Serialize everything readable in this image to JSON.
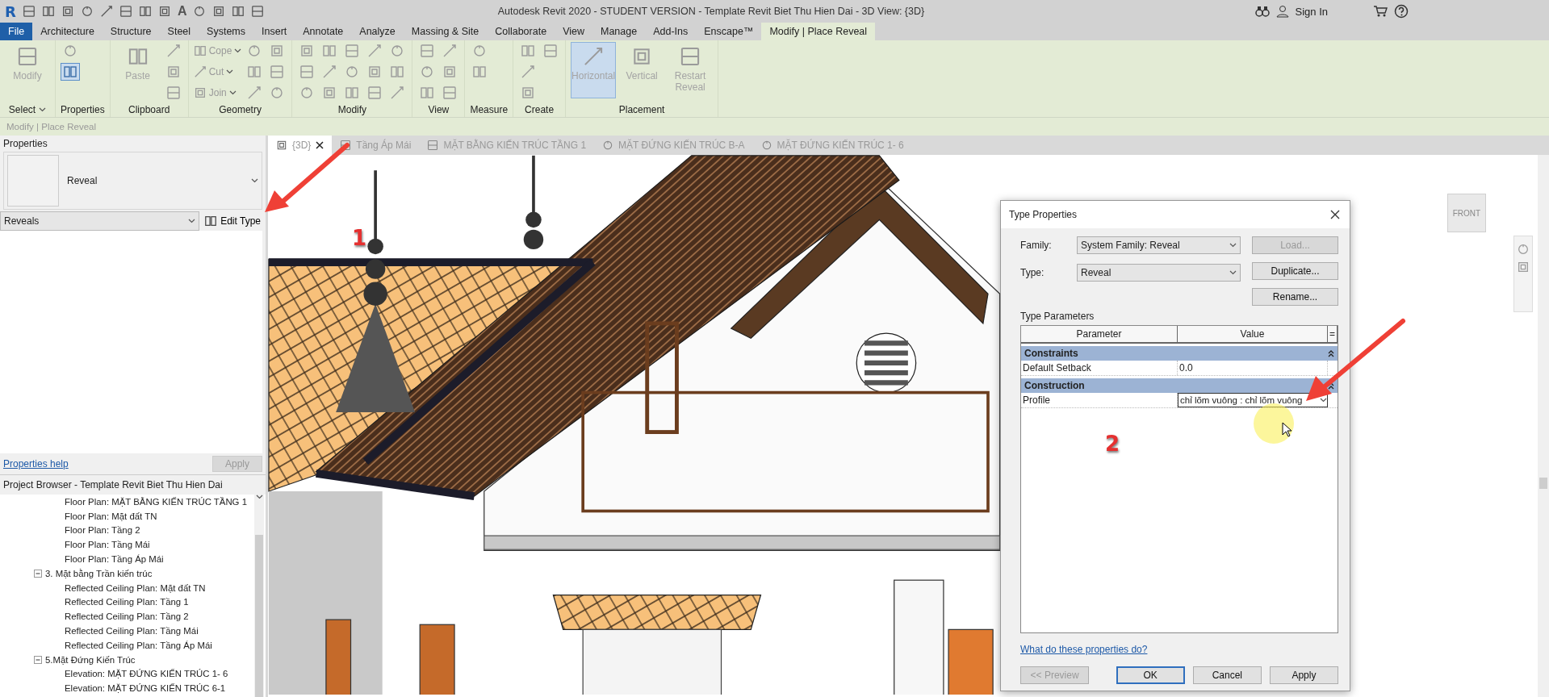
{
  "title_bar": {
    "logo": "R",
    "text_tool": "A",
    "title": "Autodesk Revit 2020 - STUDENT VERSION - Template Revit Biet Thu Hien Dai - 3D View: {3D}",
    "sign_in": "Sign In"
  },
  "menu_tabs": [
    {
      "label": "File",
      "kind": "file",
      "selected": false
    },
    {
      "label": "Architecture",
      "kind": "tab",
      "selected": false
    },
    {
      "label": "Structure",
      "kind": "tab",
      "selected": false
    },
    {
      "label": "Steel",
      "kind": "tab",
      "selected": false
    },
    {
      "label": "Systems",
      "kind": "tab",
      "selected": false
    },
    {
      "label": "Insert",
      "kind": "tab",
      "selected": false
    },
    {
      "label": "Annotate",
      "kind": "tab",
      "selected": false
    },
    {
      "label": "Analyze",
      "kind": "tab",
      "selected": false
    },
    {
      "label": "Massing & Site",
      "kind": "tab",
      "selected": false
    },
    {
      "label": "Collaborate",
      "kind": "tab",
      "selected": false
    },
    {
      "label": "View",
      "kind": "tab",
      "selected": false
    },
    {
      "label": "Manage",
      "kind": "tab",
      "selected": false
    },
    {
      "label": "Add-Ins",
      "kind": "tab",
      "selected": false
    },
    {
      "label": "Enscape™",
      "kind": "tab",
      "selected": false
    },
    {
      "label": "Modify | Place Reveal",
      "kind": "tab",
      "selected": true
    }
  ],
  "ribbon": {
    "panels": [
      {
        "label": "Select",
        "dropdown": true,
        "tools": [
          {
            "kind": "large",
            "label": "Modify",
            "selected": false
          }
        ]
      },
      {
        "label": "Properties",
        "dropdown": false,
        "tools": [
          {
            "kind": "icon",
            "selected": false
          },
          {
            "kind": "icon",
            "selected": true
          }
        ]
      },
      {
        "label": "Clipboard",
        "dropdown": false,
        "tools": [
          {
            "kind": "large",
            "label": "Paste",
            "selected": false
          },
          {
            "kind": "icon",
            "selected": false
          },
          {
            "kind": "icon",
            "selected": false
          },
          {
            "kind": "icon",
            "selected": false
          }
        ]
      },
      {
        "label": "Geometry",
        "dropdown": false,
        "tools": [
          {
            "kind": "small",
            "label": "Cope",
            "selected": false
          },
          {
            "kind": "small",
            "label": "Cut",
            "selected": false
          },
          {
            "kind": "small",
            "label": "Join",
            "selected": false
          },
          {
            "kind": "icon",
            "selected": false
          },
          {
            "kind": "icon",
            "selected": false
          },
          {
            "kind": "icon",
            "selected": false
          },
          {
            "kind": "icon",
            "selected": false
          },
          {
            "kind": "icon",
            "selected": false
          },
          {
            "kind": "icon",
            "selected": false
          }
        ]
      },
      {
        "label": "Modify",
        "dropdown": false,
        "tools": [
          {
            "kind": "icon",
            "selected": false
          },
          {
            "kind": "icon",
            "selected": false
          },
          {
            "kind": "icon",
            "selected": false
          },
          {
            "kind": "icon",
            "selected": false
          },
          {
            "kind": "icon",
            "selected": false
          },
          {
            "kind": "icon",
            "selected": false
          },
          {
            "kind": "icon",
            "selected": false
          },
          {
            "kind": "icon",
            "selected": false
          },
          {
            "kind": "icon",
            "selected": false
          },
          {
            "kind": "icon",
            "selected": false
          },
          {
            "kind": "icon",
            "selected": false
          },
          {
            "kind": "icon",
            "selected": false
          },
          {
            "kind": "icon",
            "selected": false
          },
          {
            "kind": "icon",
            "selected": false
          },
          {
            "kind": "icon",
            "selected": false
          }
        ]
      },
      {
        "label": "View",
        "dropdown": false,
        "tools": [
          {
            "kind": "icon",
            "selected": false
          },
          {
            "kind": "icon",
            "selected": false
          },
          {
            "kind": "icon",
            "selected": false
          },
          {
            "kind": "icon",
            "selected": false
          },
          {
            "kind": "icon",
            "selected": false
          },
          {
            "kind": "icon",
            "selected": false
          }
        ]
      },
      {
        "label": "Measure",
        "dropdown": false,
        "tools": [
          {
            "kind": "icon",
            "selected": false
          },
          {
            "kind": "icon",
            "selected": false
          }
        ]
      },
      {
        "label": "Create",
        "dropdown": false,
        "tools": [
          {
            "kind": "icon",
            "selected": false
          },
          {
            "kind": "icon",
            "selected": false
          },
          {
            "kind": "icon",
            "selected": false
          },
          {
            "kind": "icon",
            "selected": false
          }
        ]
      },
      {
        "label": "Placement",
        "dropdown": false,
        "tools": [
          {
            "kind": "large",
            "label": "Horizontal",
            "selected": true
          },
          {
            "kind": "large",
            "label": "Vertical",
            "selected": false
          },
          {
            "kind": "large",
            "label": "Restart Reveal",
            "selected": false
          }
        ]
      }
    ]
  },
  "options_bar": {
    "text": "Modify | Place Reveal"
  },
  "properties": {
    "title": "Properties",
    "type_name": "Reveal",
    "filter": "Reveals",
    "edit_type": "Edit Type",
    "help_link": "Properties help",
    "apply": "Apply"
  },
  "project_browser": {
    "title": "Project Browser - Template Revit Biet Thu Hien Dai",
    "tree": [
      {
        "label": "Floor Plan: MẶT BẰNG KIẾN TRÚC TẦNG 1"
      },
      {
        "label": "Floor Plan: Mặt đất TN"
      },
      {
        "label": "Floor Plan: Tầng 2"
      },
      {
        "label": "Floor Plan: Tầng Mái"
      },
      {
        "label": "Floor Plan: Tầng Áp Mái"
      },
      {
        "label": "3. Mặt bằng Trần kiến trúc",
        "expanded": true,
        "children": [
          {
            "label": "Reflected Ceiling Plan: Mặt đất TN"
          },
          {
            "label": "Reflected Ceiling Plan: Tầng 1"
          },
          {
            "label": "Reflected Ceiling Plan: Tầng 2"
          },
          {
            "label": "Reflected Ceiling Plan: Tầng Mái"
          },
          {
            "label": "Reflected Ceiling Plan: Tầng Áp Mái"
          }
        ]
      },
      {
        "label": "5.Mặt Đứng Kiến Trúc",
        "expanded": true,
        "children": [
          {
            "label": "Elevation: MẶT ĐỨNG KIẾN TRÚC 1- 6"
          },
          {
            "label": "Elevation: MẶT ĐỨNG KIẾN TRÚC 6-1"
          }
        ]
      }
    ]
  },
  "view_tabs": [
    {
      "label": "{3D}",
      "kind": "model",
      "selected": true
    },
    {
      "label": "Tầng Áp Mái",
      "kind": "plan",
      "selected": false
    },
    {
      "label": "MẶT BẰNG KIẾN TRÚC TẦNG 1",
      "kind": "plan",
      "selected": false
    },
    {
      "label": "MẶT ĐỨNG KIẾN TRÚC B-A",
      "kind": "elevation",
      "selected": false
    },
    {
      "label": "MẶT ĐỨNG KIẾN TRÚC 1- 6",
      "kind": "elevation",
      "selected": false
    }
  ],
  "view_cube": {
    "face": "FRONT"
  },
  "annotations": [
    {
      "number": "1"
    },
    {
      "number": "2"
    }
  ],
  "dialog": {
    "title": "Type Properties",
    "fields": [
      {
        "label": "Family:",
        "value": "System Family: Reveal"
      },
      {
        "label": "Type:",
        "value": "Reveal"
      }
    ],
    "side_buttons": [
      {
        "label": "Load...",
        "disabled": true
      },
      {
        "label": "Duplicate...",
        "disabled": false
      },
      {
        "label": "Rename...",
        "disabled": false
      }
    ],
    "section": "Type Parameters",
    "columns": [
      "Parameter",
      "Value",
      "="
    ],
    "groups": [
      {
        "name": "Constraints",
        "expanded": true,
        "rows": [
          {
            "parameter": "Default Setback",
            "value": "0.0",
            "kind": "text"
          }
        ]
      },
      {
        "name": "Construction",
        "expanded": true,
        "rows": [
          {
            "parameter": "Profile",
            "value": "chỉ lõm vuông : chỉ lõm vuông",
            "kind": "dropdown"
          }
        ]
      }
    ],
    "help_link": "What do these properties do?",
    "buttons": [
      {
        "label": "<< Preview",
        "disabled": true,
        "default": false
      },
      {
        "label": "OK",
        "disabled": false,
        "default": true
      },
      {
        "label": "Cancel",
        "disabled": false,
        "default": false
      },
      {
        "label": "Apply",
        "disabled": false,
        "default": false
      }
    ]
  }
}
